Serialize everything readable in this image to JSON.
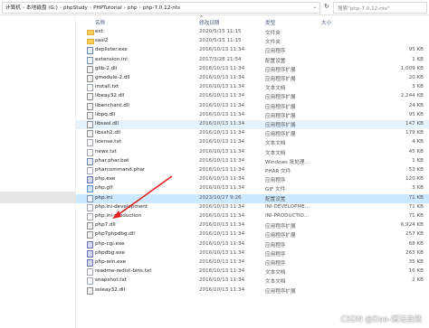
{
  "address_bar": {
    "crumbs": [
      "计算机",
      "本地磁盘 (G:)",
      "phpStudy",
      "PHPTutorial",
      "php",
      "php-7.0.12-nts"
    ],
    "search_placeholder": "搜索\"php-7.0.12-nts\""
  },
  "columns": {
    "name": "名称",
    "date": "修改日期",
    "type": "类型",
    "size": "大小"
  },
  "files": [
    {
      "name": "ext",
      "date": "2020/5/15 11:15",
      "type": "文件夹",
      "size": "",
      "icon": "folder-icon"
    },
    {
      "name": "sasl2",
      "date": "2020/5/15 11:15",
      "type": "文件夹",
      "size": "",
      "icon": "folder-icon"
    },
    {
      "name": "deplister.exe",
      "date": "2016/10/13 11:34",
      "type": "应用程序",
      "size": "95 KB",
      "icon": "exe-icon"
    },
    {
      "name": "extension.ini",
      "date": "2017/3/28 21:54",
      "type": "配置设置",
      "size": "1 KB",
      "icon": "settings-file-icon"
    },
    {
      "name": "glib-2.dll",
      "date": "2016/10/13 11:34",
      "type": "应用程序扩展",
      "size": "1,009 KB",
      "icon": "dll-icon"
    },
    {
      "name": "gmodule-2.dll",
      "date": "2016/10/13 11:34",
      "type": "应用程序扩展",
      "size": "20 KB",
      "icon": "dll-icon"
    },
    {
      "name": "install.txt",
      "date": "2016/10/13 11:34",
      "type": "文本文档",
      "size": "3 KB",
      "icon": "document-icon"
    },
    {
      "name": "libeay32.dll",
      "date": "2016/10/13 11:34",
      "type": "应用程序扩展",
      "size": "2,244 KB",
      "icon": "dll-icon"
    },
    {
      "name": "libenchant.dll",
      "date": "2016/10/13 11:34",
      "type": "应用程序扩展",
      "size": "24 KB",
      "icon": "dll-icon"
    },
    {
      "name": "libpq.dll",
      "date": "2016/10/13 11:34",
      "type": "应用程序扩展",
      "size": "95 KB",
      "icon": "dll-icon"
    },
    {
      "name": "libsasl.dll",
      "date": "2016/10/13 11:34",
      "type": "应用程序扩展",
      "size": "147 KB",
      "icon": "dll-icon"
    },
    {
      "name": "libssh2.dll",
      "date": "2016/10/13 11:34",
      "type": "应用程序扩展",
      "size": "179 KB",
      "icon": "dll-icon"
    },
    {
      "name": "license.txt",
      "date": "2016/10/13 11:34",
      "type": "文本文档",
      "size": "4 KB",
      "icon": "document-icon"
    },
    {
      "name": "news.txt",
      "date": "2016/10/13 11:34",
      "type": "文本文档",
      "size": "45 KB",
      "icon": "document-icon"
    },
    {
      "name": "phar.phar.bat",
      "date": "2016/10/13 11:34",
      "type": "Windows 批处理...",
      "size": "1 KB",
      "icon": "batch-file-icon"
    },
    {
      "name": "pharcommand.phar",
      "date": "2016/10/13 11:34",
      "type": "PHAR 文件",
      "size": "53 KB",
      "icon": "document-icon"
    },
    {
      "name": "php.exe",
      "date": "2016/10/13 11:34",
      "type": "应用程序",
      "size": "120 KB",
      "icon": "php-exe-icon"
    },
    {
      "name": "php.gif",
      "date": "2016/10/13 11:34",
      "type": "GIF 文件",
      "size": "3 KB",
      "icon": "image-icon"
    },
    {
      "name": "php.ini",
      "date": "2023/10/27 9:26",
      "type": "配置设置",
      "size": "71 KB",
      "icon": "settings-file-icon"
    },
    {
      "name": "php.ini-development",
      "date": "2016/10/13 11:34",
      "type": "INI-DEVELOPME...",
      "size": "71 KB",
      "icon": "document-icon"
    },
    {
      "name": "php.ini-production",
      "date": "2016/10/13 11:34",
      "type": "INI-PRODUCTIO...",
      "size": "71 KB",
      "icon": "document-icon"
    },
    {
      "name": "php7.dll",
      "date": "2016/10/13 11:34",
      "type": "应用程序扩展",
      "size": "6,924 KB",
      "icon": "dll-icon"
    },
    {
      "name": "php7phpdbg.dll",
      "date": "2016/10/13 11:34",
      "type": "应用程序扩展",
      "size": "257 KB",
      "icon": "dll-icon"
    },
    {
      "name": "php-cgi.exe",
      "date": "2016/10/13 11:34",
      "type": "应用程序",
      "size": "68 KB",
      "icon": "php-exe-icon"
    },
    {
      "name": "phpdbg.exe",
      "date": "2016/10/13 11:34",
      "type": "应用程序",
      "size": "263 KB",
      "icon": "php-exe-icon"
    },
    {
      "name": "php-win.exe",
      "date": "2016/10/13 11:34",
      "type": "应用程序",
      "size": "35 KB",
      "icon": "php-exe-icon"
    },
    {
      "name": "readme-redist-bins.txt",
      "date": "2016/10/13 11:34",
      "type": "文本文档",
      "size": "16 KB",
      "icon": "document-icon"
    },
    {
      "name": "snapshot.txt",
      "date": "2016/10/13 11:34",
      "type": "文本文档",
      "size": "2 KB",
      "icon": "document-icon"
    },
    {
      "name": "ssleay32.dll",
      "date": "2016/10/13 11:34",
      "type": "应用程序扩展",
      "size": "",
      "icon": "dll-icon"
    }
  ],
  "selected_file": "php.ini",
  "hovered_file": "libsasl.dll",
  "watermark": "CSDN @Dao-道法自然",
  "colors": {
    "selection": "#cce8ff",
    "hover": "#e5f3ff",
    "arrow": "#e02020"
  }
}
